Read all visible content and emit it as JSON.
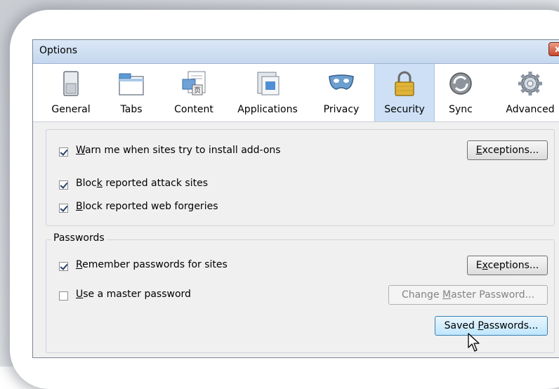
{
  "window": {
    "title": "Options",
    "close_label": "x"
  },
  "tabs": [
    {
      "label": "General",
      "icon": "switch-icon"
    },
    {
      "label": "Tabs",
      "icon": "tabs-window-icon"
    },
    {
      "label": "Content",
      "icon": "content-page-icon"
    },
    {
      "label": "Applications",
      "icon": "applications-icon"
    },
    {
      "label": "Privacy",
      "icon": "mask-icon"
    },
    {
      "label": "Security",
      "icon": "padlock-icon",
      "active": true
    },
    {
      "label": "Sync",
      "icon": "sync-icon"
    },
    {
      "label": "Advanced",
      "icon": "gear-icon"
    }
  ],
  "addons_group": {
    "warn": {
      "pre": "",
      "accel": "W",
      "post": "arn me when sites try to install add-ons",
      "checked": true
    },
    "exceptions_pre": "",
    "exceptions_accel": "E",
    "exceptions_post": "xceptions...",
    "block_attack": {
      "pre": "Bloc",
      "accel": "k",
      "post": " reported attack sites",
      "checked": true
    },
    "block_forgeries": {
      "pre": "",
      "accel": "B",
      "post": "lock reported web forgeries",
      "checked": true
    }
  },
  "passwords_group": {
    "legend": "Passwords",
    "remember": {
      "pre": "",
      "accel": "R",
      "post": "emember passwords for sites",
      "checked": true
    },
    "exceptions_pre": "E",
    "exceptions_accel": "x",
    "exceptions_post": "ceptions...",
    "master": {
      "pre": "",
      "accel": "U",
      "post": "se a master password",
      "checked": false
    },
    "change_master_pre": "Change ",
    "change_master_accel": "M",
    "change_master_post": "aster Password...",
    "saved_pre": "Saved ",
    "saved_accel": "P",
    "saved_post": "asswords..."
  },
  "colors": {
    "accent": "#cde0f5",
    "close": "#c8462d"
  }
}
